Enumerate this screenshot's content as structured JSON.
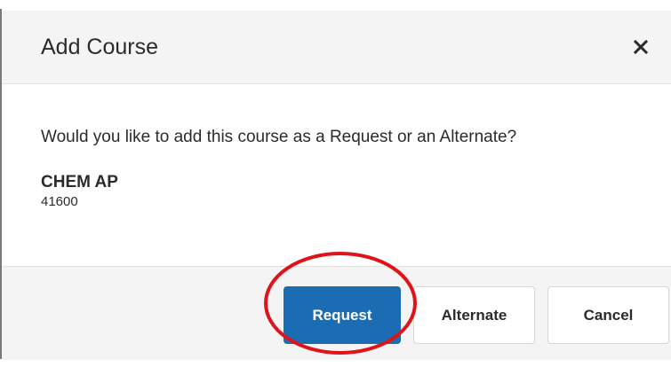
{
  "dialog": {
    "title": "Add Course",
    "close_icon": "close-icon",
    "message": "Would you like to add this course as a Request or an Alternate?",
    "course": {
      "name": "CHEM AP",
      "code": "41600"
    },
    "buttons": {
      "request": "Request",
      "alternate": "Alternate",
      "cancel": "Cancel"
    }
  },
  "colors": {
    "primary": "#1b6db3",
    "annotation": "#e0131a",
    "header_bg": "#f4f4f4"
  }
}
